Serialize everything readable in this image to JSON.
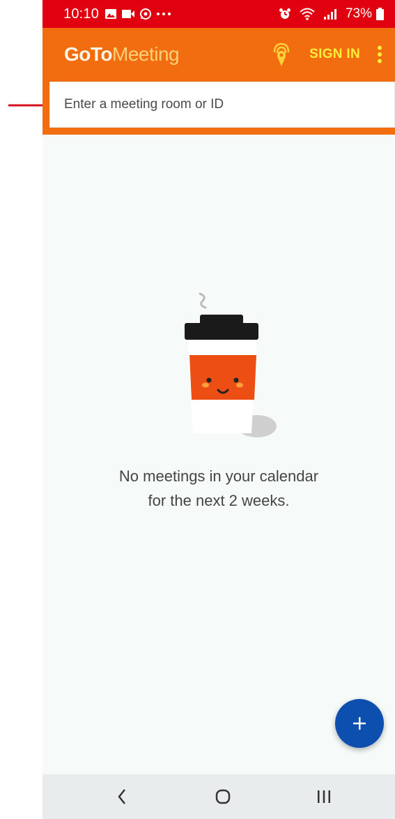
{
  "status_bar": {
    "time": "10:10",
    "notification_icons": [
      "gallery-icon",
      "video-icon",
      "whatsapp-icon",
      "more-notifications-icon"
    ],
    "system_icons": [
      "alarm-icon",
      "wifi-icon",
      "signal-icon",
      "battery-icon"
    ],
    "battery": "73%",
    "background_color": "#e10010"
  },
  "app_header": {
    "brand_goto": "GoTo",
    "brand_meeting": "Meeting",
    "sign_in_label": "SIGN IN",
    "background_color": "#f26d10"
  },
  "search": {
    "placeholder": "Enter a meeting room or ID"
  },
  "empty_state": {
    "line1": "No meetings in your calendar",
    "line2": "for the next 2 weeks."
  },
  "fab": {
    "icon": "plus-icon",
    "color": "#0d4fae"
  },
  "nav_bar": {
    "icons": [
      "back-icon",
      "home-icon",
      "recents-icon"
    ]
  },
  "annotation": {
    "icon": "red-arrow-icon",
    "color": "#d3111b"
  }
}
